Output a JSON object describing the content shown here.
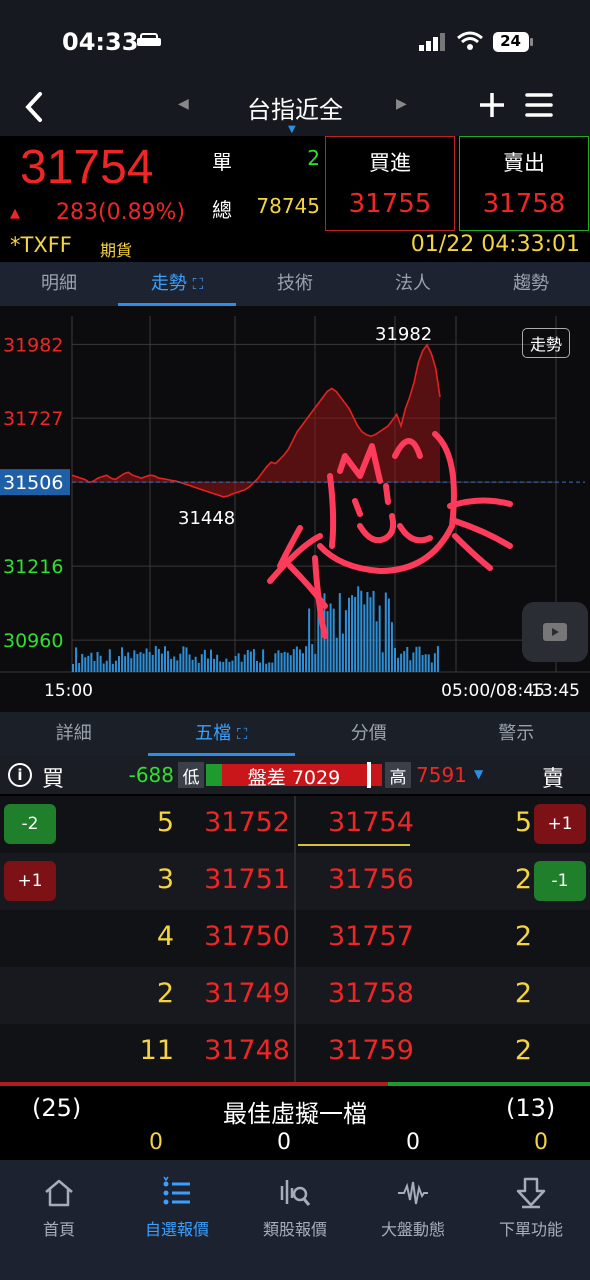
{
  "status_bar": {
    "time": "04:33",
    "battery": "24"
  },
  "header": {
    "title": "台指近全"
  },
  "quote": {
    "last_price": "31754",
    "change": "283(0.89%)",
    "single_label": "單",
    "single_value": "2",
    "total_label": "總",
    "total_value": "78745",
    "buy_label": "買進",
    "buy_price": "31755",
    "sell_label": "賣出",
    "sell_price": "31758",
    "symbol": "*TXFF",
    "symbol_type": "期貨",
    "datetime": "01/22 04:33:01"
  },
  "top_tabs": [
    "明細",
    "走勢",
    "技術",
    "法人",
    "趨勢"
  ],
  "top_tabs_active": 1,
  "chart_data": {
    "type": "line",
    "y_ticks": [
      "31982",
      "31727",
      "31506",
      "31216",
      "30960"
    ],
    "y_tick_values": [
      31982,
      31727,
      31506,
      31216,
      30960
    ],
    "ylim": [
      30850,
      32080
    ],
    "reference_price": 31506,
    "high_label": "31982",
    "low_label": "31448",
    "x_tick_labels": [
      "15:00",
      "05:00/08:45",
      "13:45"
    ],
    "mode_button": "走勢",
    "series": [
      {
        "values": [
          31530,
          31525,
          31520,
          31515,
          31505,
          31510,
          31520,
          31525,
          31530,
          31520,
          31515,
          31525,
          31535,
          31540,
          31530,
          31525,
          31520,
          31525,
          31530,
          31528,
          31520,
          31518,
          31515,
          31512,
          31510,
          31505,
          31500,
          31495,
          31490,
          31485,
          31480,
          31475,
          31470,
          31465,
          31460,
          31455,
          31458,
          31465,
          31470,
          31475,
          31480,
          31490,
          31505,
          31520,
          31540,
          31560,
          31575,
          31570,
          31585,
          31600,
          31620,
          31650,
          31680,
          31700,
          31720,
          31740,
          31760,
          31780,
          31800,
          31820,
          31830,
          31820,
          31800,
          31780,
          31760,
          31730,
          31700,
          31680,
          31670,
          31665,
          31670,
          31680,
          31690,
          31700,
          31720,
          31740,
          31700,
          31760,
          31800,
          31850,
          31920,
          31960,
          31980,
          31950,
          31900,
          31800
        ]
      }
    ],
    "volume_max_fraction": 0.95
  },
  "mid_tabs": [
    "詳細",
    "五檔",
    "分價",
    "警示"
  ],
  "mid_tabs_active": 1,
  "spread": {
    "buy_label": "買",
    "buy_diff": "-688",
    "low_label": "低",
    "spread_text": "盤差 7029",
    "high_label": "高",
    "high_value": "7591",
    "sell_label": "賣"
  },
  "order_book": [
    {
      "bid_chip": "-2",
      "bid_chip_color": "green",
      "bid_qty": "5",
      "bid_price": "31752",
      "ask_price": "31754",
      "ask_qty": "5",
      "ask_chip": "+1",
      "ask_chip_color": "red"
    },
    {
      "bid_chip": "+1",
      "bid_chip_color": "red",
      "bid_qty": "3",
      "bid_price": "31751",
      "ask_price": "31756",
      "ask_qty": "2",
      "ask_chip": "-1",
      "ask_chip_color": "green"
    },
    {
      "bid_chip": "",
      "bid_qty": "4",
      "bid_price": "31750",
      "ask_price": "31757",
      "ask_qty": "2",
      "ask_chip": ""
    },
    {
      "bid_chip": "",
      "bid_qty": "2",
      "bid_price": "31749",
      "ask_price": "31758",
      "ask_qty": "2",
      "ask_chip": ""
    },
    {
      "bid_chip": "",
      "bid_qty": "11",
      "bid_price": "31748",
      "ask_price": "31759",
      "ask_qty": "2",
      "ask_chip": ""
    }
  ],
  "best_virtual": {
    "left": "(25)",
    "title": "最佳虛擬一檔",
    "right": "(13)",
    "values": [
      "0",
      "0",
      "0",
      "0"
    ]
  },
  "bottom_nav": [
    {
      "label": "首頁",
      "icon": "home-icon"
    },
    {
      "label": "自選報價",
      "icon": "list-icon"
    },
    {
      "label": "類股報價",
      "icon": "analysis-icon"
    },
    {
      "label": "大盤動態",
      "icon": "pulse-icon"
    },
    {
      "label": "下單功能",
      "icon": "order-icon"
    }
  ],
  "bottom_nav_active": 1,
  "colors": {
    "up": "#ef2626",
    "down": "#2ee12e",
    "accent": "#2a8fe8",
    "highlight": "#f5d442"
  }
}
